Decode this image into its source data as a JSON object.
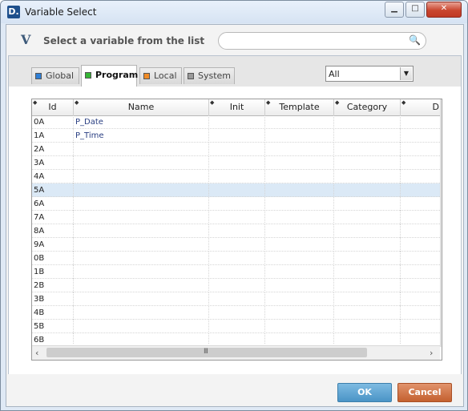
{
  "window": {
    "title": "Variable Select",
    "app_icon": "D.",
    "minimize_glyph": "▁",
    "maximize_glyph": "□",
    "close_glyph": "✕"
  },
  "header": {
    "brand_glyph": "V",
    "label": "Select a variable from the list",
    "search": {
      "value": "",
      "placeholder": "",
      "icon": "search-icon",
      "icon_glyph": "🔍"
    }
  },
  "tabs": [
    {
      "label": "Global",
      "color": "#2f7fd6",
      "active": false
    },
    {
      "label": "Program",
      "color": "#35b535",
      "active": true
    },
    {
      "label": "Local",
      "color": "#f08b26",
      "active": false
    },
    {
      "label": "System",
      "color": "#9a9a9a",
      "active": false
    }
  ],
  "filter": {
    "selected": "All",
    "arrow_glyph": "▼"
  },
  "grid": {
    "sort_glyph": "◆",
    "columns": [
      "Id",
      "Name",
      "Init",
      "Template",
      "Category",
      "D"
    ],
    "rows": [
      {
        "id": "0A",
        "name": "P_Date"
      },
      {
        "id": "1A",
        "name": "P_Time"
      },
      {
        "id": "2A",
        "name": ""
      },
      {
        "id": "3A",
        "name": ""
      },
      {
        "id": "4A",
        "name": ""
      },
      {
        "id": "5A",
        "name": "",
        "selected": true
      },
      {
        "id": "6A",
        "name": ""
      },
      {
        "id": "7A",
        "name": ""
      },
      {
        "id": "8A",
        "name": ""
      },
      {
        "id": "9A",
        "name": ""
      },
      {
        "id": "0B",
        "name": ""
      },
      {
        "id": "1B",
        "name": ""
      },
      {
        "id": "2B",
        "name": ""
      },
      {
        "id": "3B",
        "name": ""
      },
      {
        "id": "4B",
        "name": ""
      },
      {
        "id": "5B",
        "name": ""
      },
      {
        "id": "6B",
        "name": ""
      }
    ],
    "scroll": {
      "grip_glyph": "≡",
      "down_glyph": "▼",
      "left_glyph": "‹",
      "right_glyph": "›",
      "h_grip_glyph": "III"
    }
  },
  "footer": {
    "ok_label": "OK",
    "cancel_label": "Cancel",
    "ok_color": "#5ba3d3",
    "cancel_color": "#d4713f"
  }
}
